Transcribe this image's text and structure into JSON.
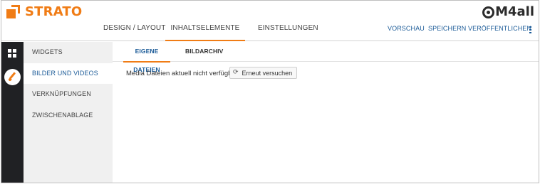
{
  "brand": {
    "left": "STRATO",
    "right_suffix": "M4all"
  },
  "nav": {
    "design": "DESIGN / LAYOUT",
    "inhalt": "INHALTSELEMENTE",
    "einstellungen": "EINSTELLUNGEN"
  },
  "actions": {
    "vorschau": "VORSCHAU",
    "speichern": "SPEICHERN",
    "veroeffentlichen": "VERÖFFENTLICHEN"
  },
  "rail": {
    "icons": [
      "widgets-grid-icon",
      "brush-icon"
    ]
  },
  "sidebar": {
    "items": [
      {
        "label": "WIDGETS",
        "active": false
      },
      {
        "label": "BILDER UND VIDEOS",
        "active": true
      },
      {
        "label": "VERKNÜPFUNGEN",
        "active": false
      },
      {
        "label": "ZWISCHENABLAGE",
        "active": false
      }
    ]
  },
  "tabs": {
    "eigene": "EIGENE DATEIEN",
    "bildarchiv": "BILDARCHIV"
  },
  "content": {
    "message": "Media Dateien aktuell nicht verfügbar.",
    "retry_label": "Erneut versuchen",
    "retry_icon": "refresh-icon"
  },
  "colors": {
    "accent": "#f07c15",
    "link": "#1a5a97",
    "rail": "#202124",
    "sidebar": "#f0f0f0"
  }
}
